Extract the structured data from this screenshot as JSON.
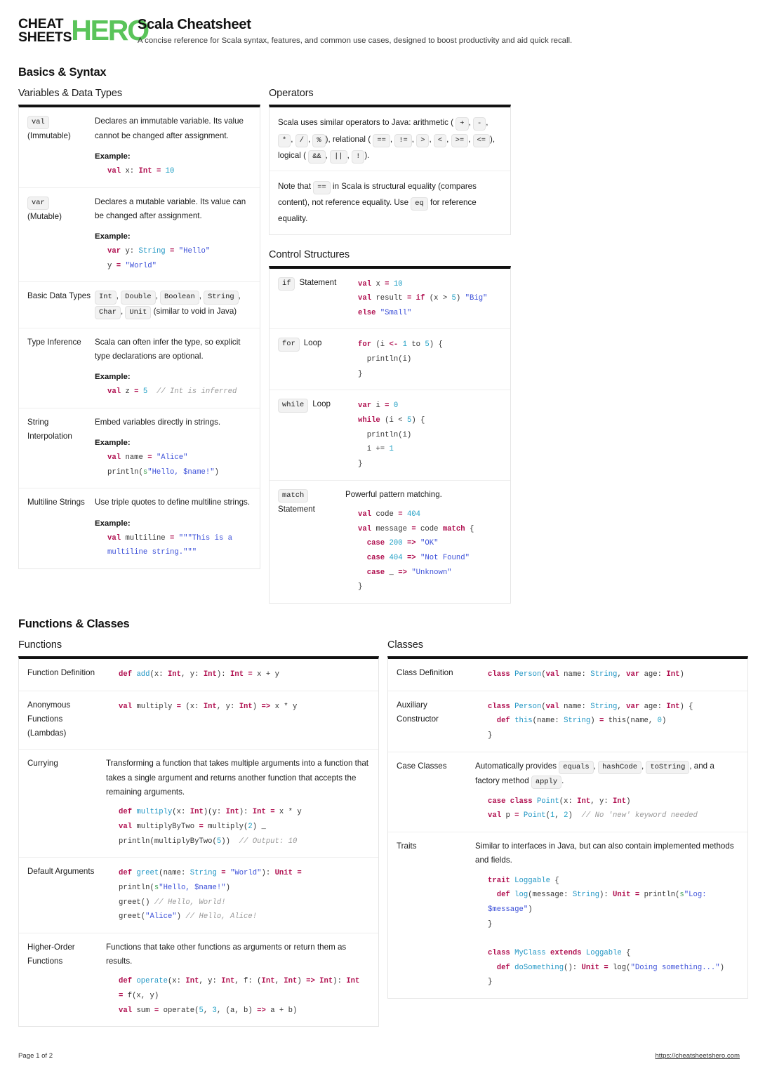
{
  "brand": {
    "line1": "CHEAT",
    "line2": "SHEETS",
    "hero": "HERO",
    "green": "#5ac45a"
  },
  "header": {
    "title": "Scala Cheatsheet",
    "subtitle": "A concise reference for Scala syntax, features, and common use cases, designed to boost productivity and aid quick recall."
  },
  "sections": {
    "basics": {
      "title": "Basics & Syntax"
    },
    "functions_classes": {
      "title": "Functions & Classes"
    }
  },
  "variables": {
    "title": "Variables & Data Types",
    "rows": [
      {
        "chip": "val",
        "label_suffix": "(Immutable)",
        "desc": "Declares an immutable variable. Its value cannot be changed after assignment.",
        "example_label": "Example:",
        "code": "val x: Int = 10"
      },
      {
        "chip": "var",
        "label_suffix": "(Mutable)",
        "desc": "Declares a mutable variable. Its value can be changed after assignment.",
        "example_label": "Example:",
        "code": "var y: String = \"Hello\"\ny = \"World\""
      },
      {
        "label": "Basic Data Types",
        "chips": [
          "Int",
          "Double",
          "Boolean",
          "String",
          "Char",
          "Unit"
        ],
        "trailing": "(similar to void in Java)"
      },
      {
        "label": "Type Inference",
        "desc": "Scala can often infer the type, so explicit type declarations are optional.",
        "example_label": "Example:",
        "code": "val z = 5  // Int is inferred"
      },
      {
        "label": "String Interpolation",
        "desc": "Embed variables directly in strings.",
        "example_label": "Example:",
        "code": "val name = \"Alice\"\nprintln(s\"Hello, $name!\")"
      },
      {
        "label": "Multiline Strings",
        "desc": "Use triple quotes to define multiline strings.",
        "example_label": "Example:",
        "code": "val multiline = \"\"\"This is a multiline string.\"\"\""
      }
    ]
  },
  "operators": {
    "title": "Operators",
    "intro_a": "Scala uses similar operators to Java: arithmetic (",
    "arith": [
      "+",
      "-",
      "*",
      "/",
      "%"
    ],
    "intro_b": "), relational (",
    "rel": [
      "==",
      "!=",
      ">",
      "<",
      ">=",
      "<="
    ],
    "intro_c": "), logical (",
    "logic": [
      "&&",
      "||",
      "!"
    ],
    "intro_d": ").",
    "note_a": "Note that",
    "note_chip1": "==",
    "note_b": "in Scala is structural equality (compares content), not reference equality. Use",
    "note_chip2": "eq",
    "note_c": "for reference equality."
  },
  "control": {
    "title": "Control Structures",
    "rows": [
      {
        "chip": "if",
        "label_suffix": "Statement",
        "code": "val x = 10\nval result = if (x > 5) \"Big\"\nelse \"Small\""
      },
      {
        "chip": "for",
        "label_suffix": "Loop",
        "code": "for (i <- 1 to 5) {\n  println(i)\n}"
      },
      {
        "chip": "while",
        "label_suffix": "Loop",
        "code": "var i = 0\nwhile (i < 5) {\n  println(i)\n  i += 1\n}"
      },
      {
        "chip": "match",
        "label_suffix": "Statement",
        "desc": "Powerful pattern matching.",
        "code": "val code = 404\nval message = code match {\n  case 200 => \"OK\"\n  case 404 => \"Not Found\"\n  case _ => \"Unknown\"\n}"
      }
    ]
  },
  "functions": {
    "title": "Functions",
    "rows": [
      {
        "label": "Function Definition",
        "code": "def add(x: Int, y: Int): Int = x + y"
      },
      {
        "label": "Anonymous Functions (Lambdas)",
        "code": "val multiply = (x: Int, y: Int) => x * y"
      },
      {
        "label": "Currying",
        "desc": "Transforming a function that takes multiple arguments into a function that takes a single argument and returns another function that accepts the remaining arguments.",
        "code": "def multiply(x: Int)(y: Int): Int = x * y\nval multiplyByTwo = multiply(2) _\nprintln(multiplyByTwo(5))  // Output: 10"
      },
      {
        "label": "Default Arguments",
        "code": "def greet(name: String = \"World\"): Unit =\nprintln(s\"Hello, $name!\")\ngreet() // Hello, World!\ngreet(\"Alice\") // Hello, Alice!"
      },
      {
        "label": "Higher-Order Functions",
        "desc": "Functions that take other functions as arguments or return them as results.",
        "code": "def operate(x: Int, y: Int, f: (Int, Int) => Int): Int\n= f(x, y)\nval sum = operate(5, 3, (a, b) => a + b)"
      }
    ]
  },
  "classes": {
    "title": "Classes",
    "rows": [
      {
        "label": "Class Definition",
        "code": "class Person(val name: String, var age: Int)"
      },
      {
        "label": "Auxiliary Constructor",
        "code": "class Person(val name: String, var age: Int) {\n  def this(name: String) = this(name, 0)\n}"
      },
      {
        "label": "Case Classes",
        "desc_a": "Automatically provides",
        "chips": [
          "equals",
          "hashCode",
          "toString"
        ],
        "desc_b": ", and a factory method",
        "chip_apply": "apply",
        "desc_c": ".",
        "code": "case class Point(x: Int, y: Int)\nval p = Point(1, 2)  // No 'new' keyword needed"
      },
      {
        "label": "Traits",
        "desc": "Similar to interfaces in Java, but can also contain implemented methods and fields.",
        "code": "trait Loggable {\n  def log(message: String): Unit = println(s\"Log:\n$message\")\n}\n\nclass MyClass extends Loggable {\n  def doSomething(): Unit = log(\"Doing something...\")\n}"
      }
    ]
  },
  "footer": {
    "page": "Page 1 of 2",
    "url": "https://cheatsheetshero.com"
  }
}
